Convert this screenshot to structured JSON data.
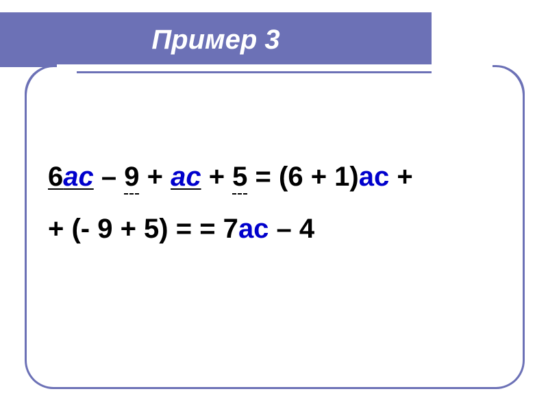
{
  "header": {
    "title": "Пример 3"
  },
  "colors": {
    "accent": "#6c71b6",
    "variable": "#0000cc"
  },
  "math": {
    "line1": {
      "coef1": "6",
      "var1": "ас",
      "op1": " – ",
      "const1": "9",
      "op2": " + ",
      "var2": "ас",
      "op3": " + ",
      "const2": "5",
      "eq1": " = ",
      "group1_open": "(6 + 1)",
      "var3": "ас",
      "trail": " + "
    },
    "line2": {
      "lead": "+ (- 9 + 5) = = 7",
      "var4": "ас",
      "tail": " – 4"
    }
  }
}
